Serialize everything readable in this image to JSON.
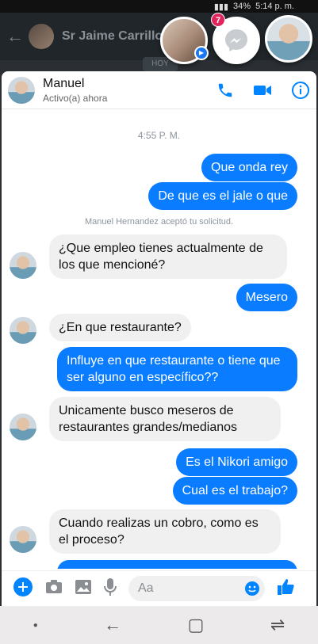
{
  "status": {
    "battery": "34%",
    "time": "5:14 p. m."
  },
  "background_app": {
    "title": "Sr Jaime Carrillo",
    "date_chip": "HOY"
  },
  "chat_heads": {
    "unread_count": "7"
  },
  "chat": {
    "contact_name": "Manuel",
    "contact_status": "Activo(a) ahora",
    "time_label": "4:55 P. M.",
    "system_note": "Manuel Hernandez aceptó tu solicitud.",
    "messages": [
      {
        "side": "out",
        "text": "Que onda rey"
      },
      {
        "side": "out",
        "text": "De que es el jale o que"
      },
      {
        "side": "in",
        "text": "¿Que empleo tienes actualmente de los que mencioné?"
      },
      {
        "side": "out",
        "text": "Mesero"
      },
      {
        "side": "in",
        "text": "¿En que restaurante?"
      },
      {
        "side": "out",
        "text": "Influye en que restaurante o tiene que ser alguno en específico??"
      },
      {
        "side": "in",
        "text": "Unicamente busco meseros de restaurantes grandes/medianos"
      },
      {
        "side": "out",
        "text": "Es el Nikori amigo"
      },
      {
        "side": "out",
        "text": "Cual es el trabajo?"
      },
      {
        "side": "in",
        "text": "Cuando realizas un cobro, como es el proceso?"
      }
    ],
    "composer_placeholder": "Aa"
  },
  "colors": {
    "outgoing": "#0a7cff",
    "incoming": "#f0f0f0",
    "accent": "#0084ff"
  },
  "icons": [
    "phone-icon",
    "video-icon",
    "info-icon",
    "plus-icon",
    "camera-icon",
    "image-icon",
    "mic-icon",
    "emoji-icon",
    "like-icon",
    "messenger-icon",
    "back-arrow-icon",
    "recents-icon",
    "home-icon"
  ]
}
